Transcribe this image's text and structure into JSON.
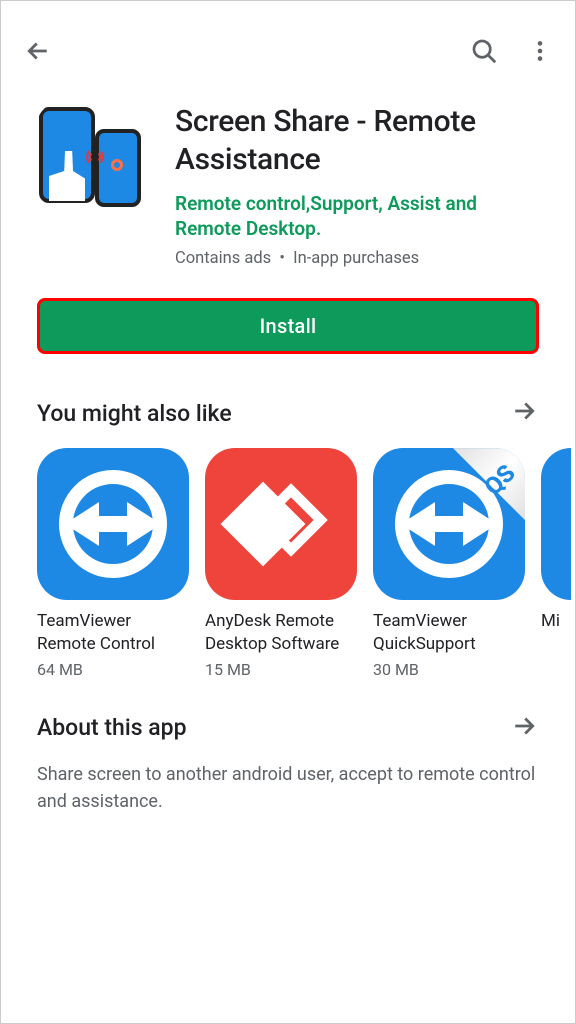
{
  "app": {
    "title": "Screen Share - Remote Assistance",
    "developer": "Remote control,Support, Assist and Remote Desktop.",
    "meta_ads": "Contains ads",
    "meta_sep": "•",
    "meta_iap": "In-app purchases",
    "install_label": "Install"
  },
  "suggestions": {
    "heading": "You might also like",
    "items": [
      {
        "name": "TeamViewer Remote Control",
        "size": "64 MB"
      },
      {
        "name": "AnyDesk Remote Desktop Software",
        "size": "15 MB"
      },
      {
        "name": "TeamViewer QuickSupport",
        "size": "30 MB"
      },
      {
        "name": "Mi",
        "size": ""
      }
    ]
  },
  "about": {
    "heading": "About this app",
    "description": "Share screen to another android user, accept to remote control and assistance."
  }
}
